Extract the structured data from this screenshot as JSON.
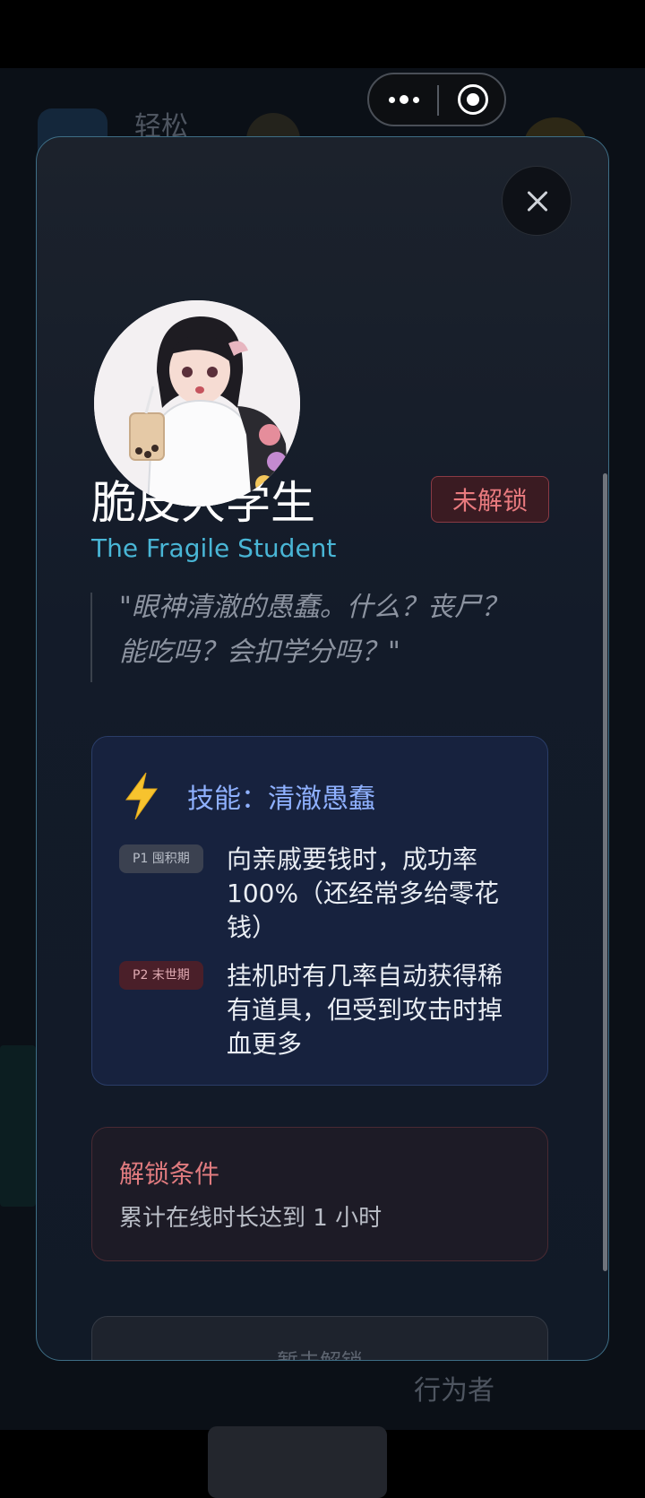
{
  "capsule": {
    "more_icon": "more-dots-icon",
    "target_icon": "target-icon"
  },
  "background": {
    "app_label": "轻松",
    "side_label": "行为者"
  },
  "modal": {
    "close_icon": "close-icon",
    "character": {
      "name_zh": "脆皮大学生",
      "name_en": "The Fragile Student",
      "status_badge": "未解锁",
      "quote": "\"眼神清澈的愚蠢。什么？丧尸？能吃吗？会扣学分吗？\""
    },
    "skill": {
      "icon": "lightning-icon",
      "title": "技能：清澈愚蠢",
      "phases": [
        {
          "tag": "P1 囤积期",
          "text": "向亲戚要钱时，成功率 100%（还经常多给零花钱）"
        },
        {
          "tag": "P2 末世期",
          "text": "挂机时有几率自动获得稀有道具，但受到攻击时掉血更多"
        }
      ]
    },
    "unlock": {
      "title": "解锁条件",
      "desc": "累计在线时长达到 1 小时"
    },
    "bottom_button": {
      "label": "暂未解锁"
    }
  },
  "colors": {
    "accent_cyan": "#49b6d6",
    "skill_blue": "#8fb1ff",
    "locked_red": "#e87a7e",
    "card_navy": "#17223e"
  }
}
